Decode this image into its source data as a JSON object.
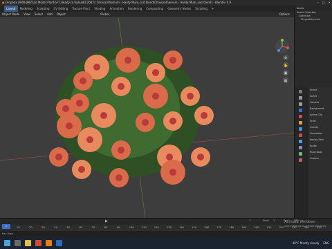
{
  "window": {
    "title": "Dropbox (ARN-JINV)\\3d Model Plants\\FT_Ready to Upload\\C20871 Chrysanthemum - Hardy Mum_cult.blend\\Chrysanthemum - Hardy Mum_cult.blend] - Blender 4.0",
    "minimize": "–",
    "maximize": "□",
    "close": "✕"
  },
  "workspaces": [
    "Layout",
    "Modeling",
    "Sculpting",
    "UV Editing",
    "Texture Paint",
    "Shading",
    "Animation",
    "Rendering",
    "Compositing",
    "Geometry Nodes",
    "Scripting",
    "+"
  ],
  "active_workspace": "Layout",
  "scene_label": "Scene",
  "viewport": {
    "menu": [
      "Object Mode",
      "View",
      "Select",
      "Add",
      "Object"
    ],
    "pivot": "Global",
    "options": "Options",
    "nav_buttons": [
      "⊕",
      "✋",
      "🎥",
      "▦"
    ]
  },
  "outliner": {
    "header": "Scene Collection",
    "rows": [
      "Scene Collection",
      "Collection",
      "Chrysanthemum"
    ]
  },
  "properties": {
    "title": "Scene",
    "rows": [
      "Scene",
      "Camera",
      "Background",
      "Active Clip",
      "Units",
      "Gravity",
      "Simulation",
      "Keying Sets",
      "Audio",
      "Rigid Body",
      "Custom"
    ]
  },
  "timeline": {
    "ticks": [
      "0",
      "10",
      "20",
      "30",
      "40",
      "50",
      "60",
      "70",
      "80",
      "90",
      "100",
      "110",
      "120",
      "130",
      "140",
      "150",
      "160",
      "170",
      "180",
      "190",
      "200",
      "210",
      "220",
      "230",
      "240",
      "250"
    ],
    "current_frame": "1",
    "start_label": "Start",
    "start": "1",
    "end_label": "End",
    "end": "250"
  },
  "status": {
    "left": "Pan View",
    "activate_title": "Activate Windows",
    "activate_sub": "Go to Settings to activate Windows."
  },
  "taskbar": {
    "weather": "40°C  Mostly cloudy",
    "time": "ENG"
  },
  "colors": {
    "accent": "#3d6fc9",
    "viewport_bg": "#3d3d3d",
    "petal": "#e8795a"
  }
}
